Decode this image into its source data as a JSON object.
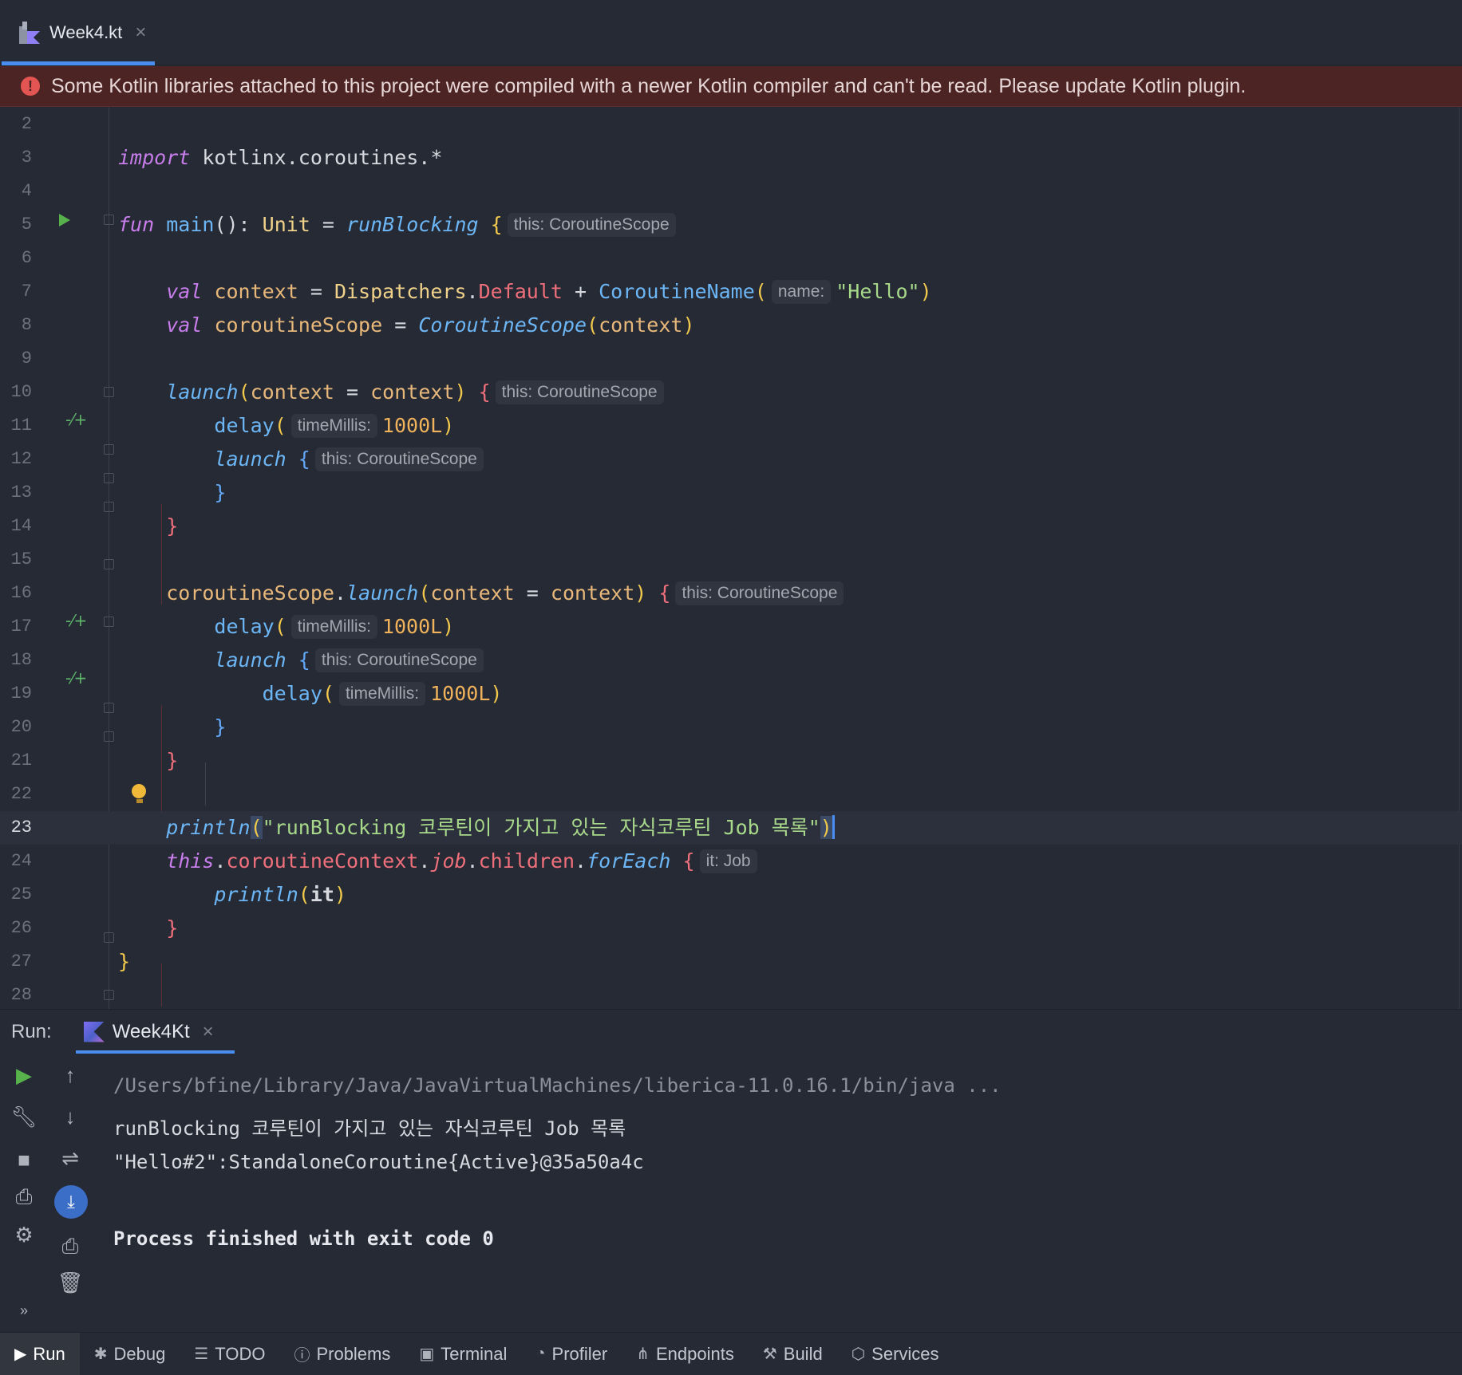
{
  "tab": {
    "file_name": "Week4.kt",
    "close": "×"
  },
  "banner": {
    "message": "Some Kotlin libraries attached to this project were compiled with a newer Kotlin compiler and can't be read. Please update Kotlin plugin."
  },
  "editor": {
    "line_numbers": [
      "2",
      "3",
      "4",
      "5",
      "6",
      "7",
      "8",
      "9",
      "10",
      "11",
      "12",
      "13",
      "14",
      "15",
      "16",
      "17",
      "18",
      "19",
      "20",
      "21",
      "22",
      "23",
      "24",
      "25",
      "26",
      "27",
      "28"
    ],
    "current_line": "23",
    "hints": {
      "scope": "this: CoroutineScope",
      "name": "name:",
      "time_millis": "timeMillis:",
      "it_job": "it: Job"
    },
    "tokens": {
      "import_kw": "import",
      "import_pkg": "kotlinx.coroutines.*",
      "fun_kw": "fun",
      "main": "main",
      "unit": "Unit",
      "run_blocking": "runBlocking",
      "val_kw": "val",
      "context": "context",
      "dispatchers": "Dispatchers",
      "default": "Default",
      "coroutine_name": "CoroutineName",
      "hello": "\"Hello\"",
      "coroutine_scope_var": "coroutineScope",
      "coroutine_scope_fn": "CoroutineScope",
      "launch": "launch",
      "delay": "delay",
      "literal_1000": "1000L",
      "println": "println",
      "println_arg": "\"runBlocking 코루틴이 가지고 있는 자식코루틴 Job 목록\"",
      "this_kw": "this",
      "coroutine_context": "coroutineContext",
      "job": "job",
      "children": "children",
      "for_each": "forEach",
      "it": "it"
    }
  },
  "run_panel": {
    "label": "Run:",
    "config_name": "Week4Kt",
    "close": "×",
    "console_lines": [
      "/Users/bfine/Library/Java/JavaVirtualMachines/liberica-11.0.16.1/bin/java ...",
      "runBlocking 코루틴이 가지고 있는 자식코루틴 Job 목록",
      "\"Hello#2\":StandaloneCoroutine{Active}@35a50a4c",
      "Process finished with exit code 0"
    ]
  },
  "bottom_tools": [
    {
      "label": "Run",
      "icon": "run-icon"
    },
    {
      "label": "Debug",
      "icon": "debug-icon"
    },
    {
      "label": "TODO",
      "icon": "todo-icon"
    },
    {
      "label": "Problems",
      "icon": "problems-icon"
    },
    {
      "label": "Terminal",
      "icon": "terminal-icon"
    },
    {
      "label": "Profiler",
      "icon": "profiler-icon"
    },
    {
      "label": "Endpoints",
      "icon": "endpoints-icon"
    },
    {
      "label": "Build",
      "icon": "build-icon"
    },
    {
      "label": "Services",
      "icon": "services-icon"
    }
  ],
  "colors": {
    "accent": "#4b8cf0",
    "error_banner": "#4c2424",
    "run_green": "#58b24c"
  }
}
